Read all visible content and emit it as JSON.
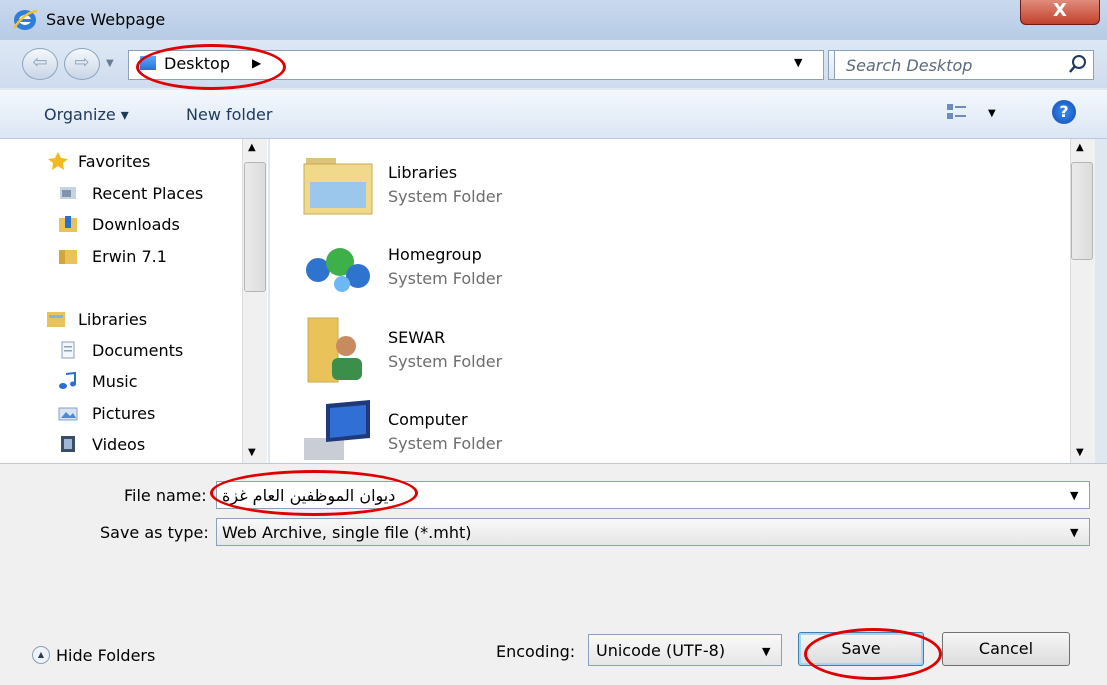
{
  "window": {
    "title": "Save Webpage",
    "close_label": "X"
  },
  "nav": {
    "breadcrumb": "Desktop",
    "search_placeholder": "Search Desktop"
  },
  "toolbar": {
    "organize_label": "Organize ▾",
    "new_folder_label": "New folder"
  },
  "sidebar": {
    "favorites": {
      "label": "Favorites",
      "items": [
        {
          "label": "Recent Places",
          "icon": "recent-places-icon"
        },
        {
          "label": "Downloads",
          "icon": "downloads-folder-icon"
        },
        {
          "label": "Erwin 7.1",
          "icon": "folder-icon"
        }
      ]
    },
    "libraries": {
      "label": "Libraries",
      "items": [
        {
          "label": "Documents",
          "icon": "documents-icon"
        },
        {
          "label": "Music",
          "icon": "music-icon"
        },
        {
          "label": "Pictures",
          "icon": "pictures-icon"
        },
        {
          "label": "Videos",
          "icon": "videos-icon"
        }
      ]
    }
  },
  "files": [
    {
      "name": "Libraries",
      "type": "System Folder",
      "icon": "libraries-folder-icon"
    },
    {
      "name": "Homegroup",
      "type": "System Folder",
      "icon": "homegroup-icon"
    },
    {
      "name": "SEWAR",
      "type": "System Folder",
      "icon": "user-folder-icon"
    },
    {
      "name": "Computer",
      "type": "System Folder",
      "icon": "computer-icon"
    }
  ],
  "form": {
    "file_name_label": "File name:",
    "file_name_value": "ديوان الموظفين العام غزة",
    "save_type_label": "Save as type:",
    "save_type_value": "Web Archive, single file (*.mht)",
    "encoding_label": "Encoding:",
    "encoding_value": "Unicode (UTF-8)",
    "hide_folders_label": "Hide Folders",
    "save_label": "Save",
    "cancel_label": "Cancel"
  },
  "colors": {
    "highlight_ellipse": "#e00000",
    "accent": "#1e395b"
  }
}
